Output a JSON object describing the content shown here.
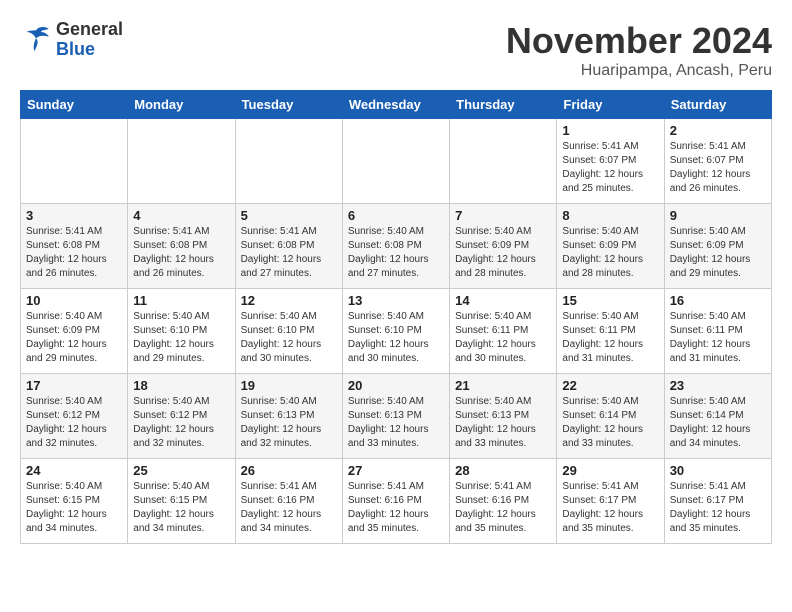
{
  "logo": {
    "text_general": "General",
    "text_blue": "Blue"
  },
  "header": {
    "month": "November 2024",
    "location": "Huaripampa, Ancash, Peru"
  },
  "weekdays": [
    "Sunday",
    "Monday",
    "Tuesday",
    "Wednesday",
    "Thursday",
    "Friday",
    "Saturday"
  ],
  "weeks": [
    [
      {
        "day": "",
        "info": ""
      },
      {
        "day": "",
        "info": ""
      },
      {
        "day": "",
        "info": ""
      },
      {
        "day": "",
        "info": ""
      },
      {
        "day": "",
        "info": ""
      },
      {
        "day": "1",
        "info": "Sunrise: 5:41 AM\nSunset: 6:07 PM\nDaylight: 12 hours and 25 minutes."
      },
      {
        "day": "2",
        "info": "Sunrise: 5:41 AM\nSunset: 6:07 PM\nDaylight: 12 hours and 26 minutes."
      }
    ],
    [
      {
        "day": "3",
        "info": "Sunrise: 5:41 AM\nSunset: 6:08 PM\nDaylight: 12 hours and 26 minutes."
      },
      {
        "day": "4",
        "info": "Sunrise: 5:41 AM\nSunset: 6:08 PM\nDaylight: 12 hours and 26 minutes."
      },
      {
        "day": "5",
        "info": "Sunrise: 5:41 AM\nSunset: 6:08 PM\nDaylight: 12 hours and 27 minutes."
      },
      {
        "day": "6",
        "info": "Sunrise: 5:40 AM\nSunset: 6:08 PM\nDaylight: 12 hours and 27 minutes."
      },
      {
        "day": "7",
        "info": "Sunrise: 5:40 AM\nSunset: 6:09 PM\nDaylight: 12 hours and 28 minutes."
      },
      {
        "day": "8",
        "info": "Sunrise: 5:40 AM\nSunset: 6:09 PM\nDaylight: 12 hours and 28 minutes."
      },
      {
        "day": "9",
        "info": "Sunrise: 5:40 AM\nSunset: 6:09 PM\nDaylight: 12 hours and 29 minutes."
      }
    ],
    [
      {
        "day": "10",
        "info": "Sunrise: 5:40 AM\nSunset: 6:09 PM\nDaylight: 12 hours and 29 minutes."
      },
      {
        "day": "11",
        "info": "Sunrise: 5:40 AM\nSunset: 6:10 PM\nDaylight: 12 hours and 29 minutes."
      },
      {
        "day": "12",
        "info": "Sunrise: 5:40 AM\nSunset: 6:10 PM\nDaylight: 12 hours and 30 minutes."
      },
      {
        "day": "13",
        "info": "Sunrise: 5:40 AM\nSunset: 6:10 PM\nDaylight: 12 hours and 30 minutes."
      },
      {
        "day": "14",
        "info": "Sunrise: 5:40 AM\nSunset: 6:11 PM\nDaylight: 12 hours and 30 minutes."
      },
      {
        "day": "15",
        "info": "Sunrise: 5:40 AM\nSunset: 6:11 PM\nDaylight: 12 hours and 31 minutes."
      },
      {
        "day": "16",
        "info": "Sunrise: 5:40 AM\nSunset: 6:11 PM\nDaylight: 12 hours and 31 minutes."
      }
    ],
    [
      {
        "day": "17",
        "info": "Sunrise: 5:40 AM\nSunset: 6:12 PM\nDaylight: 12 hours and 32 minutes."
      },
      {
        "day": "18",
        "info": "Sunrise: 5:40 AM\nSunset: 6:12 PM\nDaylight: 12 hours and 32 minutes."
      },
      {
        "day": "19",
        "info": "Sunrise: 5:40 AM\nSunset: 6:13 PM\nDaylight: 12 hours and 32 minutes."
      },
      {
        "day": "20",
        "info": "Sunrise: 5:40 AM\nSunset: 6:13 PM\nDaylight: 12 hours and 33 minutes."
      },
      {
        "day": "21",
        "info": "Sunrise: 5:40 AM\nSunset: 6:13 PM\nDaylight: 12 hours and 33 minutes."
      },
      {
        "day": "22",
        "info": "Sunrise: 5:40 AM\nSunset: 6:14 PM\nDaylight: 12 hours and 33 minutes."
      },
      {
        "day": "23",
        "info": "Sunrise: 5:40 AM\nSunset: 6:14 PM\nDaylight: 12 hours and 34 minutes."
      }
    ],
    [
      {
        "day": "24",
        "info": "Sunrise: 5:40 AM\nSunset: 6:15 PM\nDaylight: 12 hours and 34 minutes."
      },
      {
        "day": "25",
        "info": "Sunrise: 5:40 AM\nSunset: 6:15 PM\nDaylight: 12 hours and 34 minutes."
      },
      {
        "day": "26",
        "info": "Sunrise: 5:41 AM\nSunset: 6:16 PM\nDaylight: 12 hours and 34 minutes."
      },
      {
        "day": "27",
        "info": "Sunrise: 5:41 AM\nSunset: 6:16 PM\nDaylight: 12 hours and 35 minutes."
      },
      {
        "day": "28",
        "info": "Sunrise: 5:41 AM\nSunset: 6:16 PM\nDaylight: 12 hours and 35 minutes."
      },
      {
        "day": "29",
        "info": "Sunrise: 5:41 AM\nSunset: 6:17 PM\nDaylight: 12 hours and 35 minutes."
      },
      {
        "day": "30",
        "info": "Sunrise: 5:41 AM\nSunset: 6:17 PM\nDaylight: 12 hours and 35 minutes."
      }
    ]
  ]
}
